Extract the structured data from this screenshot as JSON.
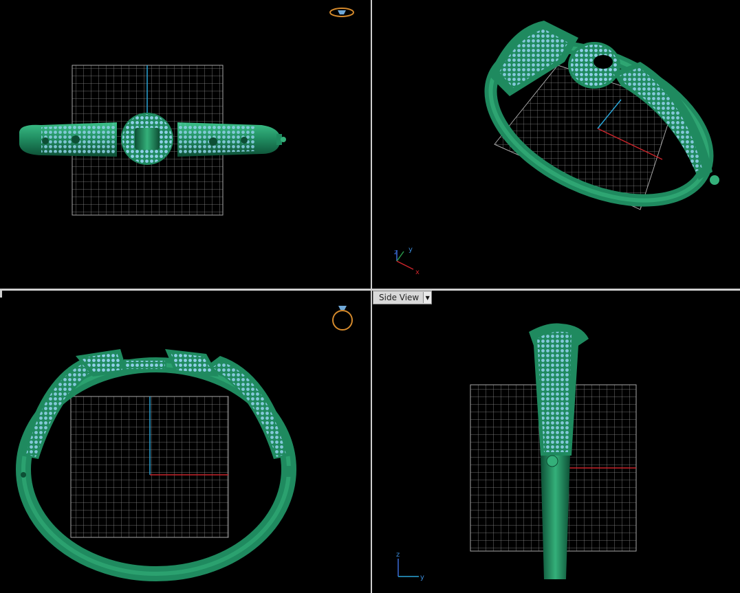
{
  "viewports": {
    "top": {
      "axis": {}
    },
    "perspective": {
      "axis": {
        "z": "z",
        "y": "y",
        "x": "x"
      }
    },
    "front": {},
    "side": {
      "label": "Side View",
      "dropdown_icon": "triangle-down-icon",
      "axis": {
        "z": "z",
        "y": "y"
      }
    }
  },
  "colors": {
    "background": "#000000",
    "metal": "#1f8a5f",
    "metal_dark": "#0d4f35",
    "metal_light": "#34b07a",
    "gems": "#8fd0e8",
    "grid": "#8e8e8e",
    "axis_x": "#c8242a",
    "axis_y": "#2aa6d8",
    "divider": "#cfcfcf",
    "ring_icon": "#d58a2c"
  }
}
